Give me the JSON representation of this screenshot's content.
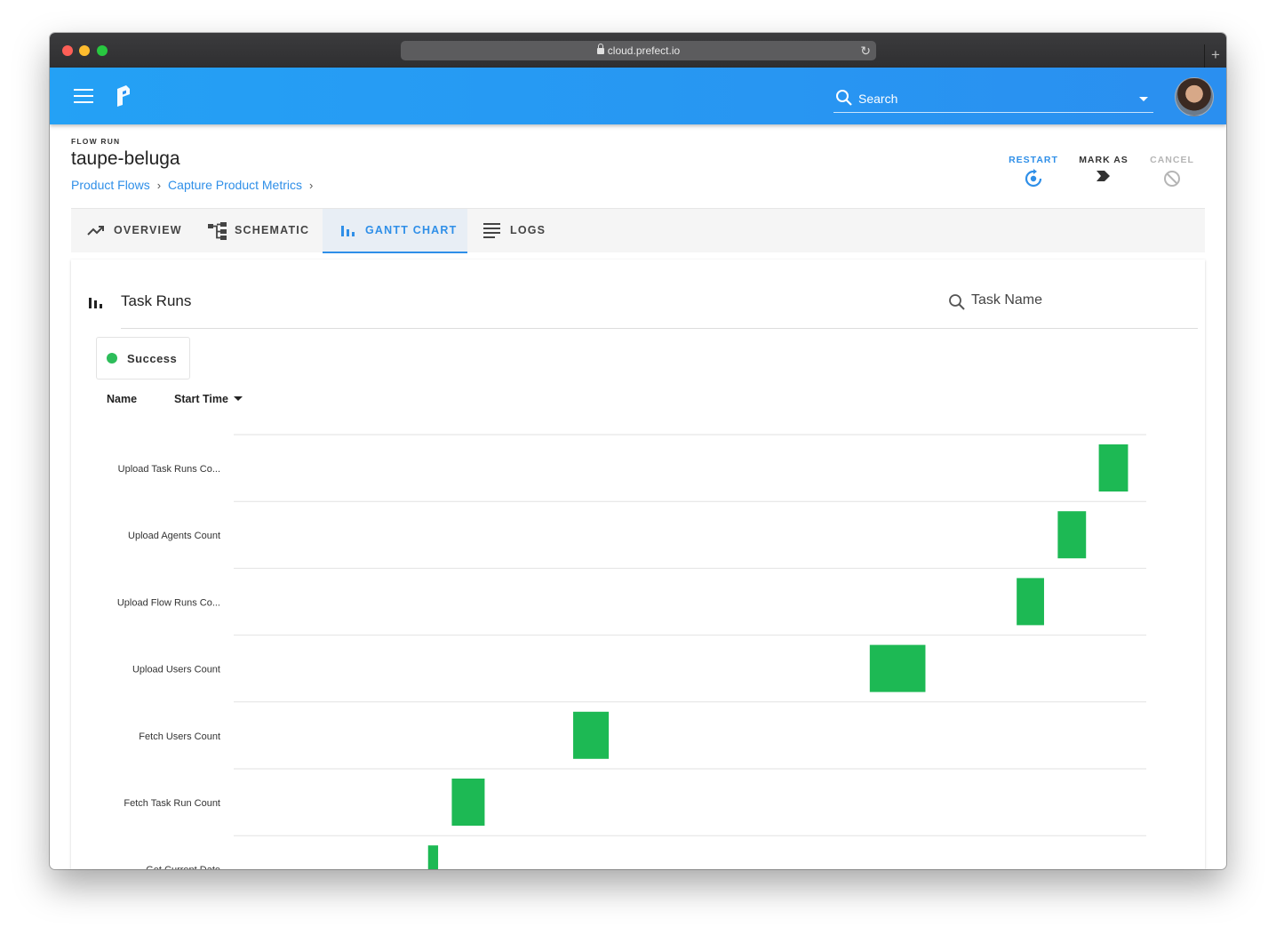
{
  "browser": {
    "url": "cloud.prefect.io"
  },
  "appbar": {
    "search_label": "Search"
  },
  "header": {
    "eyebrow": "FLOW RUN",
    "title": "taupe-beluga",
    "breadcrumbs": [
      "Product Flows",
      "Capture Product Metrics"
    ],
    "actions": {
      "restart": "RESTART",
      "mark_as": "MARK AS",
      "cancel": "CANCEL"
    }
  },
  "tabs": [
    "OVERVIEW",
    "SCHEMATIC",
    "GANTT CHART",
    "LOGS"
  ],
  "active_tab": "GANTT CHART",
  "panel": {
    "title": "Task Runs",
    "search_placeholder": "Task Name",
    "legend": "Success",
    "success_color": "#1db954",
    "columns": {
      "name": "Name",
      "sort": "Start Time"
    }
  },
  "chart_data": {
    "type": "gantt",
    "tasks": [
      {
        "name": "Upload Task Runs Co...",
        "start": 0.948,
        "end": 0.98,
        "state": "Success"
      },
      {
        "name": "Upload Agents Count",
        "start": 0.903,
        "end": 0.934,
        "state": "Success"
      },
      {
        "name": "Upload Flow Runs Co...",
        "start": 0.858,
        "end": 0.888,
        "state": "Success"
      },
      {
        "name": "Upload Users Count",
        "start": 0.697,
        "end": 0.758,
        "state": "Success"
      },
      {
        "name": "Fetch Users Count",
        "start": 0.372,
        "end": 0.411,
        "state": "Success"
      },
      {
        "name": "Fetch Task Run Count",
        "start": 0.239,
        "end": 0.275,
        "state": "Success"
      },
      {
        "name": "Get Current Date",
        "start": 0.213,
        "end": 0.224,
        "state": "Success"
      }
    ]
  }
}
